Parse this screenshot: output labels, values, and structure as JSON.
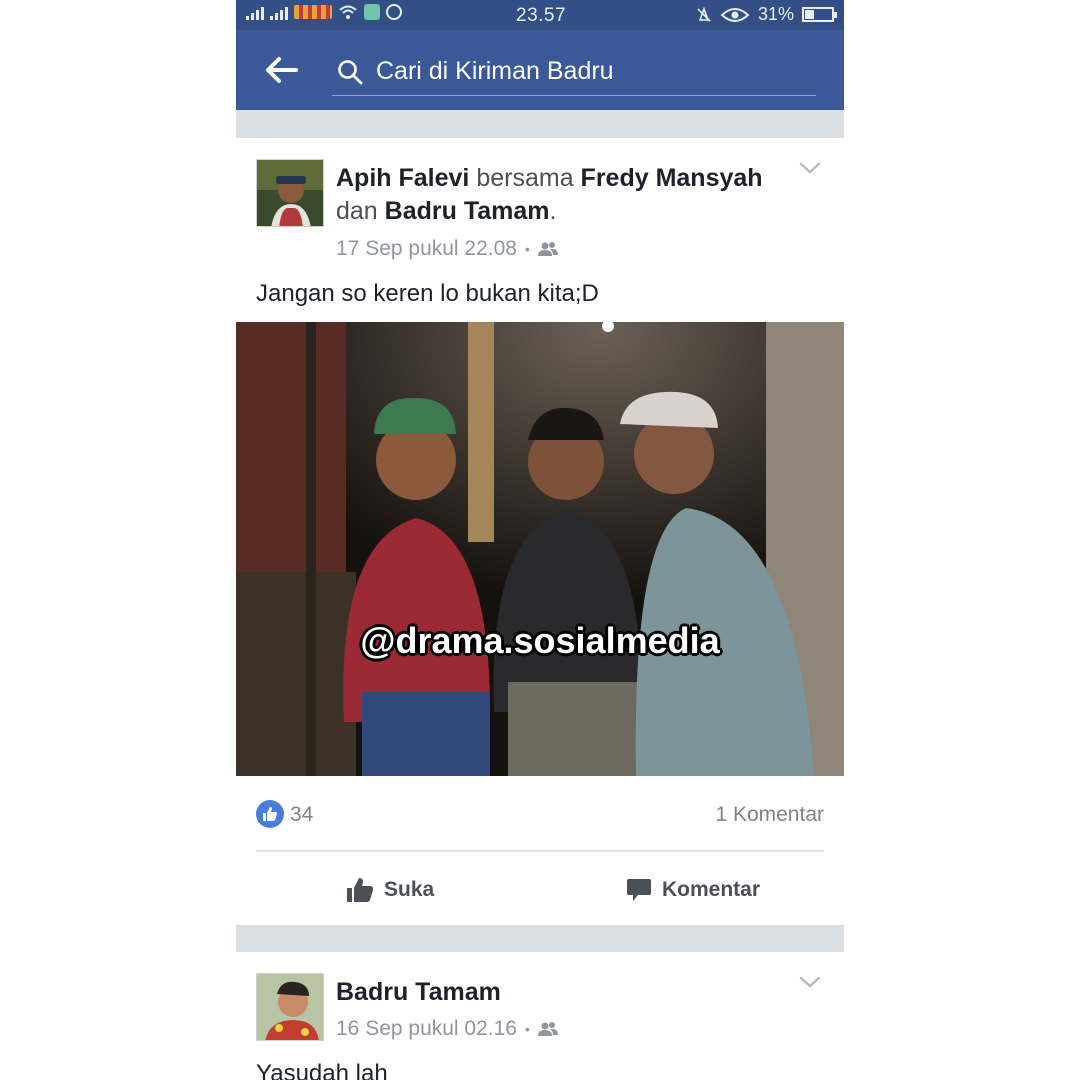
{
  "status_bar": {
    "time": "23.57",
    "battery": "31%",
    "battery_level": 0.31
  },
  "search": {
    "placeholder": "Cari di Kiriman Badru"
  },
  "post1": {
    "author": "Apih Falevi",
    "with_word": "bersama",
    "tagged_1": "Fredy Mansyah",
    "and_word": "dan",
    "tagged_2": "Badru Tamam",
    "end_punct": ".",
    "timestamp": "17 Sep pukul 22.08",
    "separator": "•",
    "text": "Jangan so keren lo bukan kita;D",
    "watermark": "@drama.sosialmedia",
    "likes": "34",
    "comments": "1 Komentar",
    "like_label": "Suka",
    "comment_label": "Komentar"
  },
  "post2": {
    "author": "Badru Tamam",
    "timestamp": "16 Sep pukul 02.16",
    "separator": "•",
    "text": "Yasudah lah"
  },
  "colors": {
    "facebook_blue": "#3b5998",
    "status_bar": "#344f86",
    "like_blue": "#4a7ddb",
    "separator_gray": "#dadfe3"
  },
  "icons": [
    "back-arrow-icon",
    "search-icon",
    "chevron-down-icon",
    "friends-icon",
    "like-icon",
    "comment-icon",
    "wifi-icon",
    "eye-icon"
  ]
}
